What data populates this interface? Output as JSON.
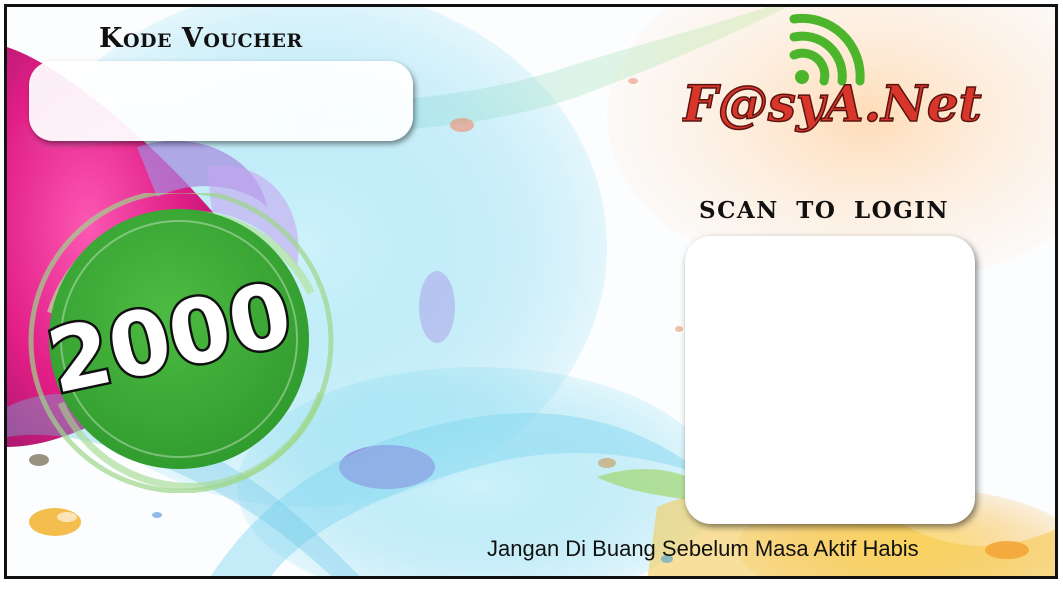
{
  "voucher": {
    "title": "Kode Voucher",
    "code": ""
  },
  "brand": {
    "logo_text": "F@syA.Net"
  },
  "scan": {
    "title": "SCAN TO LOGIN"
  },
  "price": {
    "amount": "2000"
  },
  "footer": {
    "note": "Jangan Di Buang Sebelum Masa Aktif Habis"
  },
  "colors": {
    "border": "#111111",
    "badge_green": "#3ba536",
    "logo_red": "#d8362a",
    "logo_green": "#4cb52b",
    "splash_magenta": "#e0127f",
    "splash_cyan": "#45c6e6",
    "splash_yellow": "#f2c020"
  },
  "icons": {
    "logo_signal": "wifi-signal-icon"
  }
}
